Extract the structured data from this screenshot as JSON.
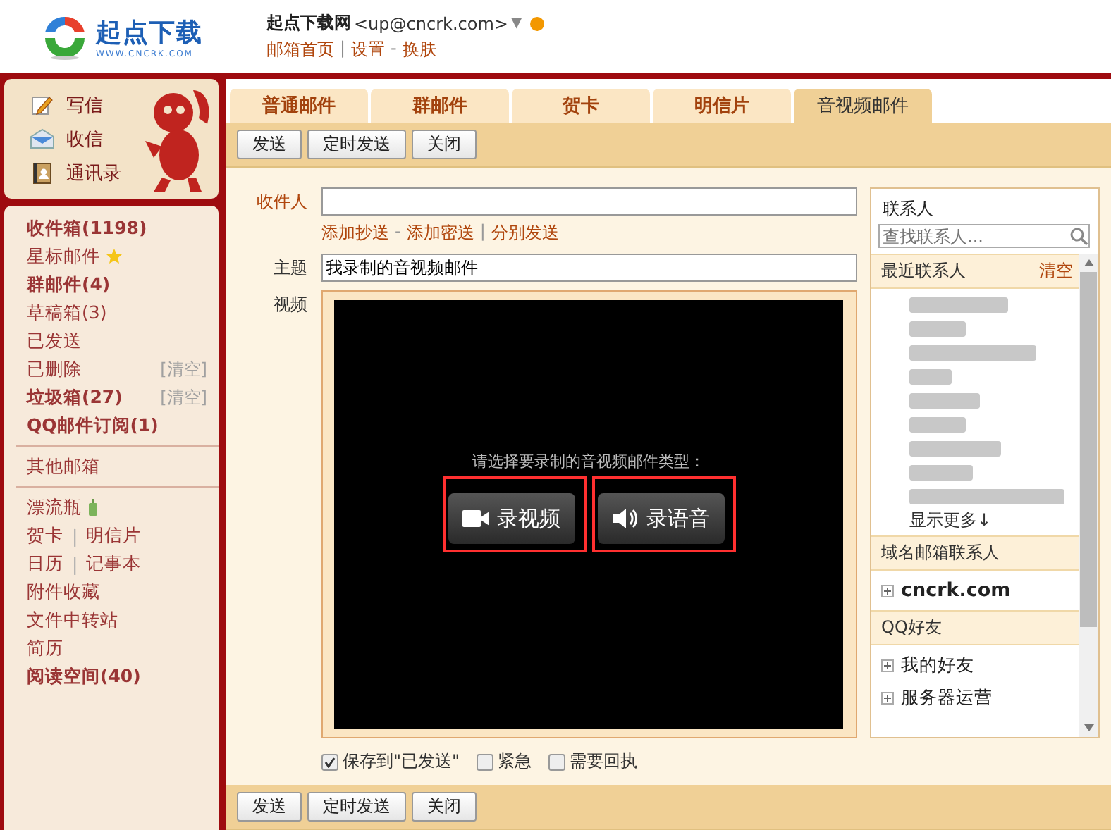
{
  "header": {
    "logo_text": "起点下载",
    "logo_url": "WWW.CNCRK.COM",
    "account_name": "起点下载网",
    "account_email": "<up@cncrk.com>",
    "caret": "▼",
    "links": [
      "邮箱首页",
      "设置",
      "换肤"
    ],
    "separators": [
      "|",
      "-"
    ]
  },
  "sidebar": {
    "actions": [
      {
        "kind": "write",
        "label": "写信"
      },
      {
        "kind": "receive",
        "label": "收信"
      },
      {
        "kind": "contacts",
        "label": "通讯录"
      }
    ],
    "folder_groups": [
      [
        {
          "label": "收件箱(1198)",
          "bold": true
        },
        {
          "label": "星标邮件",
          "kind": "starred",
          "bold": false
        },
        {
          "label": "群邮件(4)",
          "bold": true
        },
        {
          "label": "草稿箱(3)",
          "bold": false
        },
        {
          "label": "已发送",
          "bold": false
        },
        {
          "label": "已删除",
          "bold": false,
          "action": "[清空]"
        },
        {
          "label": "垃圾箱(27)",
          "bold": true,
          "action": "[清空]"
        },
        {
          "label": "QQ邮件订阅(1)",
          "bold": true
        }
      ],
      [
        {
          "label": "其他邮箱",
          "bold": false
        }
      ],
      [
        {
          "label": "漂流瓶",
          "kind": "bottle",
          "bold": false
        },
        {
          "labels": [
            "贺卡",
            "明信片"
          ],
          "separator": "|"
        },
        {
          "labels": [
            "日历",
            "记事本"
          ],
          "separator": "|"
        },
        {
          "label": "附件收藏",
          "bold": false
        },
        {
          "label": "文件中转站",
          "bold": false
        },
        {
          "label": "简历",
          "bold": false
        },
        {
          "label": "阅读空间(40)",
          "bold": true
        }
      ]
    ]
  },
  "tabs": [
    {
      "label": "普通邮件",
      "selected": false
    },
    {
      "label": "群邮件",
      "selected": false
    },
    {
      "label": "贺卡",
      "selected": false
    },
    {
      "label": "明信片",
      "selected": false
    },
    {
      "label": "音视频邮件",
      "selected": true
    }
  ],
  "toolbar_buttons": [
    "发送",
    "定时发送",
    "关闭"
  ],
  "form": {
    "recipient_label": "收件人",
    "cc_links": [
      "添加抄送",
      "添加密送",
      "分别发送"
    ],
    "cc_separators": [
      "-",
      "|"
    ],
    "subject_label": "主题",
    "subject_value": "我录制的音视频邮件",
    "video_label": "视频",
    "recorder": {
      "prompt": "请选择要录制的音视频邮件类型：",
      "buttons": [
        {
          "kind": "video",
          "label": "录视频",
          "highlighted": true
        },
        {
          "kind": "audio",
          "label": "录语音",
          "highlighted": true
        }
      ]
    },
    "options": [
      {
        "label": "保存到\"已发送\"",
        "checked": true
      },
      {
        "label": "紧急",
        "checked": false
      },
      {
        "label": "需要回执",
        "checked": false
      }
    ]
  },
  "contacts": {
    "title": "联系人",
    "search_placeholder": "查找联系人...",
    "sections": [
      {
        "title": "最近联系人",
        "action": "清空",
        "items": [
          {
            "kind": "redacted"
          },
          {
            "kind": "redacted"
          },
          {
            "kind": "redacted"
          },
          {
            "kind": "redacted"
          },
          {
            "kind": "redacted"
          },
          {
            "kind": "redacted"
          },
          {
            "kind": "redacted"
          },
          {
            "kind": "redacted"
          },
          {
            "kind": "redacted"
          },
          {
            "kind": "more",
            "label": "显示更多↓"
          }
        ]
      },
      {
        "title": "域名邮箱联系人",
        "items": [
          {
            "kind": "group",
            "label": "cncrk.com",
            "bold": true,
            "expanded": false
          }
        ]
      },
      {
        "title": "QQ好友",
        "items": [
          {
            "kind": "group",
            "label": "我的好友",
            "bold": false,
            "expanded": false
          },
          {
            "kind": "group",
            "label": "服务器运营",
            "bold": false,
            "expanded": false
          }
        ]
      }
    ]
  },
  "bottom_toolbar_buttons": [
    "发送",
    "定时发送",
    "关闭"
  ]
}
